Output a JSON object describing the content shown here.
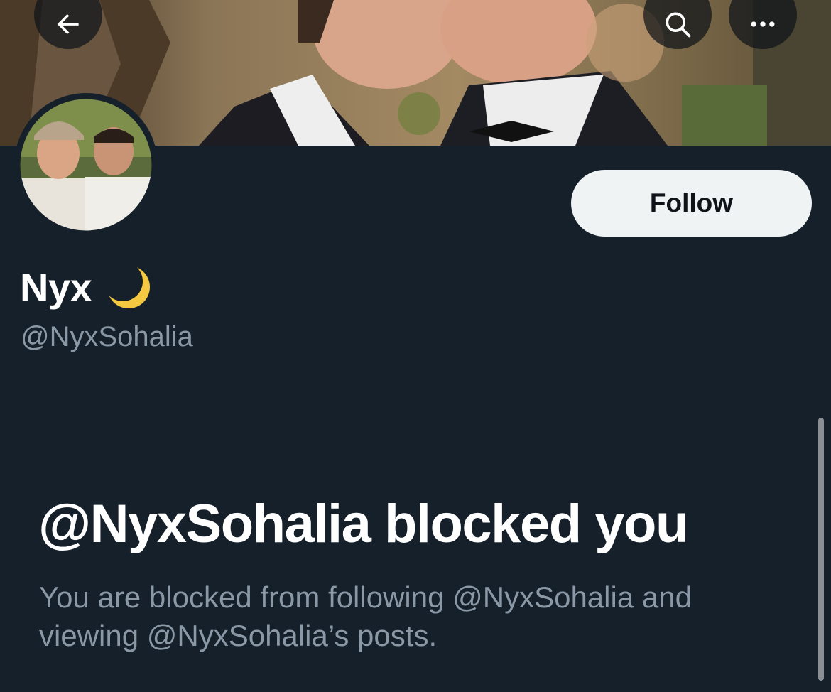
{
  "header": {
    "back_icon": "arrow-left-icon",
    "search_icon": "search-icon",
    "more_icon": "more-horizontal-icon"
  },
  "profile": {
    "display_name": "Nyx",
    "name_emoji": "crescent-moon-icon",
    "handle": "@NyxSohalia",
    "follow_label": "Follow"
  },
  "blocked": {
    "title": "@NyxSohalia blocked you",
    "description": "You are blocked from following @NyxSohalia and viewing @NyxSohalia’s posts."
  },
  "colors": {
    "background": "#15202b",
    "primary_text": "#ffffff",
    "secondary_text": "#8b98a5",
    "follow_button_bg": "#eff3f4",
    "follow_button_text": "#0f1419"
  }
}
